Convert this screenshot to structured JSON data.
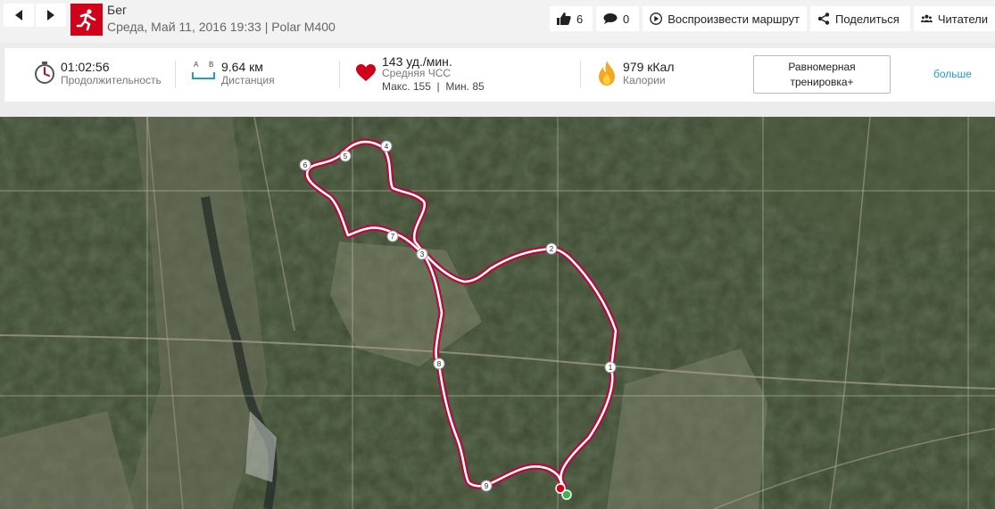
{
  "header": {
    "title": "Бег",
    "subtitle": "Среда, Май 11, 2016 19:33 | Polar M400",
    "likes": "6",
    "comments": "0",
    "play_route": "Воспроизвести маршрут",
    "share": "Поделиться",
    "readers": "Читатели"
  },
  "stats": {
    "duration_value": "01:02:56",
    "duration_label": "Продолжительность",
    "distance_value": "9.64 км",
    "distance_label": "Дистанция",
    "distance_a": "A",
    "distance_b": "B",
    "hr_value": "143 уд./мин.",
    "hr_label": "Средняя ЧСС",
    "hr_minmax": "Макс. 155  |  Мин. 85",
    "calories_value": "979 кКал",
    "calories_label": "Калории",
    "plan_button_line1": "Равномерная",
    "plan_button_line2": "тренировка+",
    "more_link": "больше"
  },
  "map": {
    "km_markers": [
      "1",
      "2",
      "3",
      "4",
      "5",
      "6",
      "7",
      "8",
      "9"
    ]
  }
}
